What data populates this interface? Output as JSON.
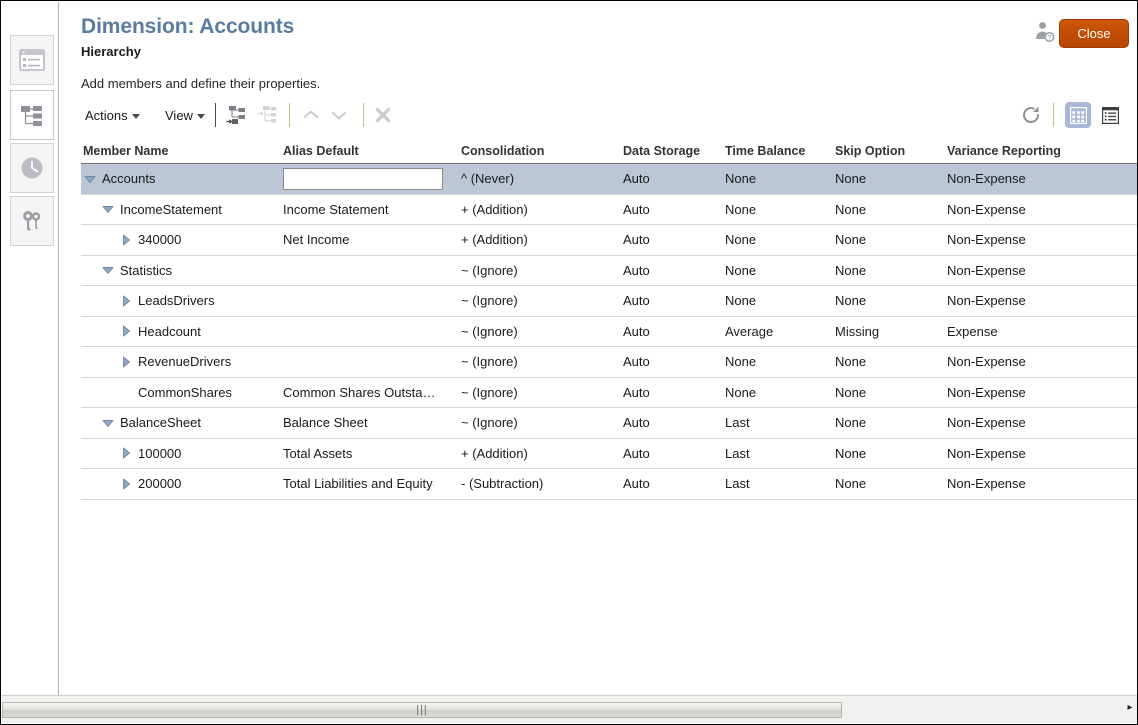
{
  "header": {
    "title": "Dimension: Accounts",
    "subtitle": "Hierarchy",
    "description": "Add members and define their properties.",
    "close_label": "Close",
    "user_icon": "user-help-icon",
    "accent_color": "#5a7c9e",
    "close_button_color": "#c04c05"
  },
  "sidebar": {
    "items": [
      {
        "name": "sidebar-item-general",
        "icon": "form-list-icon",
        "active": false
      },
      {
        "name": "sidebar-item-hierarchy",
        "icon": "hierarchy-tree-icon",
        "active": true
      },
      {
        "name": "sidebar-item-history",
        "icon": "clock-icon",
        "active": false
      },
      {
        "name": "sidebar-item-permissions",
        "icon": "keys-icon",
        "active": false
      }
    ]
  },
  "toolbar": {
    "actions_label": "Actions",
    "view_label": "View",
    "buttons": [
      {
        "name": "add-child-button",
        "icon": "add-child-icon",
        "enabled": true
      },
      {
        "name": "add-sibling-button",
        "icon": "add-sibling-icon",
        "enabled": false
      },
      {
        "name": "move-up-button",
        "icon": "chevron-up-icon",
        "enabled": false
      },
      {
        "name": "move-down-button",
        "icon": "chevron-down-icon",
        "enabled": false
      },
      {
        "name": "delete-button",
        "icon": "close-x-icon",
        "enabled": false
      }
    ],
    "refresh": {
      "name": "refresh-button",
      "icon": "refresh-icon"
    },
    "view_modes": [
      {
        "name": "grid-view-button",
        "icon": "grid-icon",
        "active": true
      },
      {
        "name": "list-view-button",
        "icon": "list-detail-icon",
        "active": false
      }
    ],
    "active_view_color": "#a9b7d8"
  },
  "table": {
    "columns": [
      "Member Name",
      "Alias Default",
      "Consolidation",
      "Data Storage",
      "Time Balance",
      "Skip Option",
      "Variance Reporting"
    ],
    "rows": [
      {
        "member": "Accounts",
        "depth": 0,
        "twisty": "expanded",
        "alias": "",
        "alias_editing": true,
        "alias_placeholder": "",
        "consolidation": "^ (Never)",
        "data_storage": "Auto",
        "time_balance": "None",
        "skip_option": "None",
        "variance_reporting": "Non-Expense",
        "selected": true
      },
      {
        "member": "IncomeStatement",
        "depth": 1,
        "twisty": "expanded",
        "alias": "Income Statement",
        "consolidation": "+ (Addition)",
        "data_storage": "Auto",
        "time_balance": "None",
        "skip_option": "None",
        "variance_reporting": "Non-Expense",
        "selected": false
      },
      {
        "member": "340000",
        "depth": 2,
        "twisty": "collapsed",
        "alias": "Net Income",
        "consolidation": "+ (Addition)",
        "data_storage": "Auto",
        "time_balance": "None",
        "skip_option": "None",
        "variance_reporting": "Non-Expense",
        "selected": false
      },
      {
        "member": "Statistics",
        "depth": 1,
        "twisty": "expanded",
        "alias": "",
        "consolidation": "~ (Ignore)",
        "data_storage": "Auto",
        "time_balance": "None",
        "skip_option": "None",
        "variance_reporting": "Non-Expense",
        "selected": false
      },
      {
        "member": "LeadsDrivers",
        "depth": 2,
        "twisty": "collapsed",
        "alias": "",
        "consolidation": "~ (Ignore)",
        "data_storage": "Auto",
        "time_balance": "None",
        "skip_option": "None",
        "variance_reporting": "Non-Expense",
        "selected": false
      },
      {
        "member": "Headcount",
        "depth": 2,
        "twisty": "collapsed",
        "alias": "",
        "consolidation": "~ (Ignore)",
        "data_storage": "Auto",
        "time_balance": "Average",
        "skip_option": "Missing",
        "variance_reporting": "Expense",
        "selected": false
      },
      {
        "member": "RevenueDrivers",
        "depth": 2,
        "twisty": "collapsed",
        "alias": "",
        "consolidation": "~ (Ignore)",
        "data_storage": "Auto",
        "time_balance": "None",
        "skip_option": "None",
        "variance_reporting": "Non-Expense",
        "selected": false
      },
      {
        "member": "CommonShares",
        "depth": 2,
        "twisty": "none",
        "alias": "Common Shares Outsta…",
        "consolidation": "~ (Ignore)",
        "data_storage": "Auto",
        "time_balance": "None",
        "skip_option": "None",
        "variance_reporting": "Non-Expense",
        "selected": false
      },
      {
        "member": "BalanceSheet",
        "depth": 1,
        "twisty": "expanded",
        "alias": "Balance Sheet",
        "consolidation": "~ (Ignore)",
        "data_storage": "Auto",
        "time_balance": "Last",
        "skip_option": "None",
        "variance_reporting": "Non-Expense",
        "selected": false
      },
      {
        "member": "100000",
        "depth": 2,
        "twisty": "collapsed",
        "alias": "Total Assets",
        "consolidation": "+ (Addition)",
        "data_storage": "Auto",
        "time_balance": "Last",
        "skip_option": "None",
        "variance_reporting": "Non-Expense",
        "selected": false
      },
      {
        "member": "200000",
        "depth": 2,
        "twisty": "collapsed",
        "alias": "Total Liabilities and Equity",
        "consolidation": "- (Subtraction)",
        "data_storage": "Auto",
        "time_balance": "Last",
        "skip_option": "None",
        "variance_reporting": "Non-Expense",
        "selected": false
      }
    ],
    "selected_row_color": "#bcc6d6",
    "twisty_color": "#92a8c4"
  },
  "scrollbar": {
    "name": "horizontal-scrollbar",
    "grip": "|||",
    "arrow": "▸"
  }
}
